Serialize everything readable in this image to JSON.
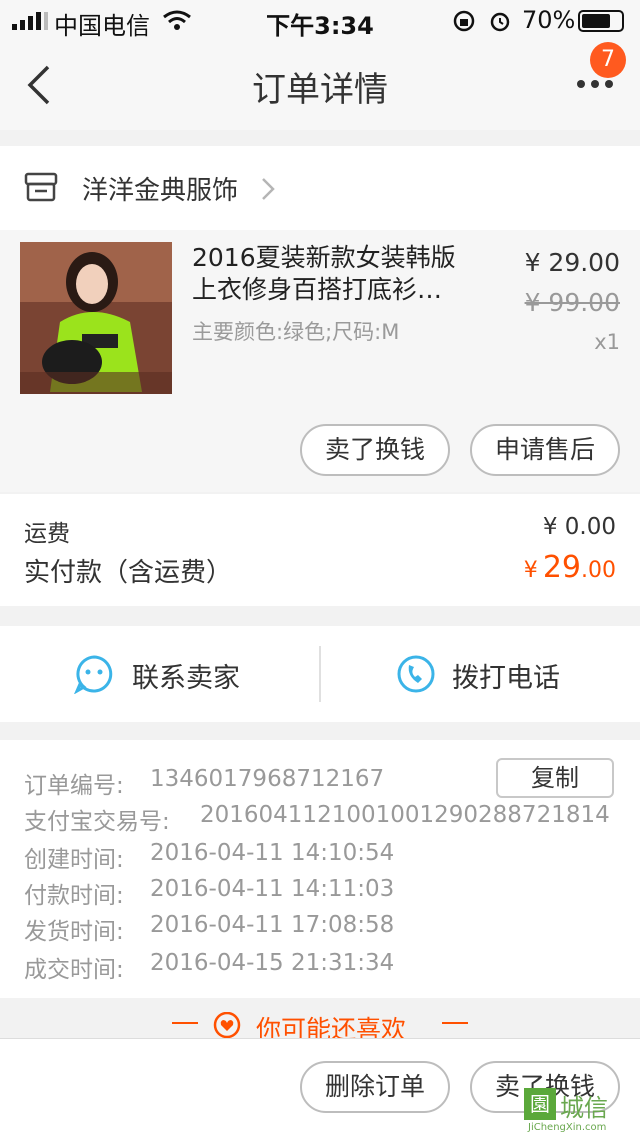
{
  "status_bar": {
    "carrier": "中国电信",
    "time": "下午3:34",
    "battery": "70%"
  },
  "nav": {
    "title": "订单详情",
    "badge_count": "7"
  },
  "shop": {
    "name": "洋洋金典服饰"
  },
  "product": {
    "title_line1": "2016夏装新款女装韩版",
    "title_line2": "上衣修身百搭打底衫…",
    "sku": "主要颜色:绿色;尺码:M",
    "price": "¥ 29.00",
    "original_price": "¥ 99.00",
    "quantity": "x1"
  },
  "product_actions": {
    "sell_label": "卖了换钱",
    "after_sale_label": "申请售后"
  },
  "summary": {
    "shipping_label": "运费",
    "shipping_value": "¥ 0.00",
    "paid_label": "实付款（含运费）",
    "paid_currency": "¥",
    "paid_int": "29",
    "paid_dec": ".00"
  },
  "contact": {
    "seller_label": "联系卖家",
    "phone_label": "拨打电话"
  },
  "order_info": {
    "copy_label": "复制",
    "rows": [
      {
        "label": "订单编号:",
        "value": "1346017968712167"
      },
      {
        "label": "支付宝交易号:",
        "value": "2016041121001001290288721814"
      },
      {
        "label": "创建时间:",
        "value": "2016-04-11 14:10:54"
      },
      {
        "label": "付款时间:",
        "value": "2016-04-11 14:11:03"
      },
      {
        "label": "发货时间:",
        "value": "2016-04-11 17:08:58"
      },
      {
        "label": "成交时间:",
        "value": "2016-04-15 21:31:34"
      }
    ]
  },
  "recommend": {
    "title": "你可能还喜欢"
  },
  "bottom_bar": {
    "delete_label": "删除订单",
    "sell_label": "卖了换钱"
  },
  "watermark": {
    "text": "城信",
    "url": "JiChengXin.com"
  },
  "colors": {
    "accent": "#ff5000",
    "badge": "#ff5a1f",
    "contact_icon": "#3bb4e8"
  },
  "icons": {
    "back": "chevron-left-icon",
    "more": "more-dots-icon",
    "shop": "shop-icon",
    "shop_arrow": "chevron-right-icon",
    "seller": "smiley-chat-icon",
    "phone": "phone-icon",
    "recommend": "heart-icon"
  }
}
